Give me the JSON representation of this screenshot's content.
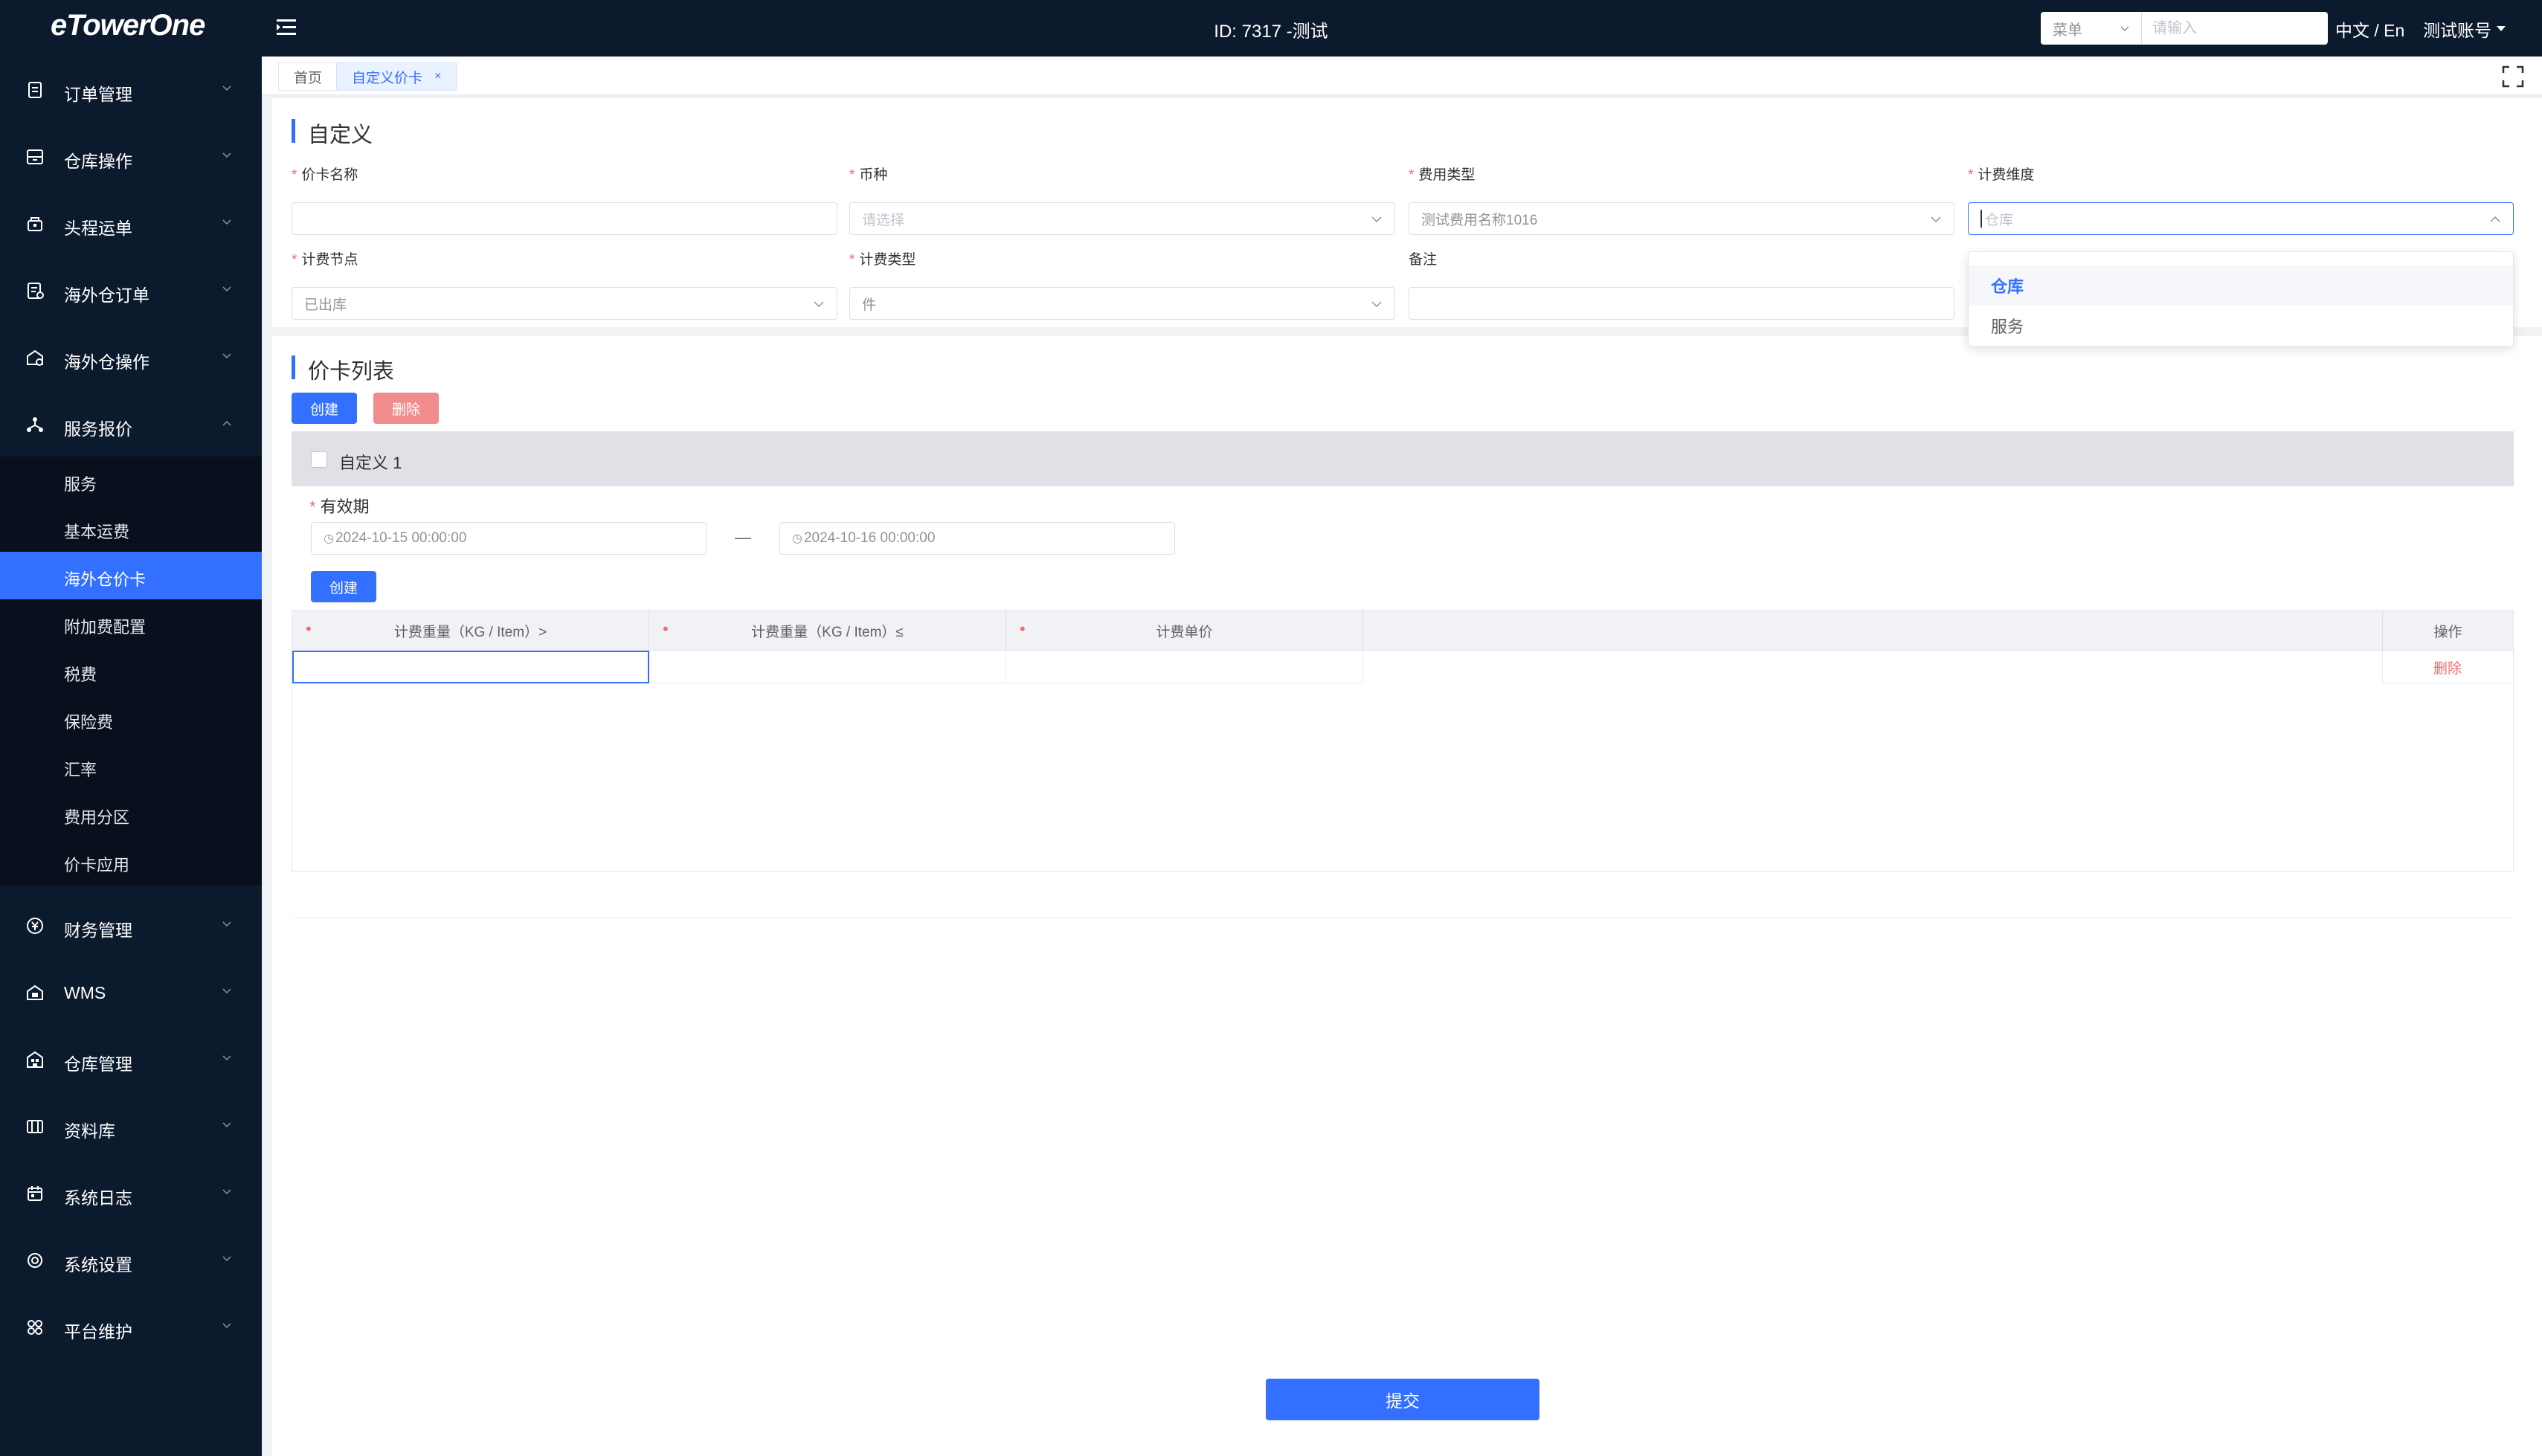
{
  "app": {
    "logo": "eTowerOne",
    "title": "ID: 7317 -测试",
    "search_select": "菜单",
    "search_placeholder": "请输入",
    "language": "中文 / En",
    "account": "测试账号"
  },
  "sidebar": {
    "items": [
      {
        "label": "订单管理",
        "icon": "document-icon"
      },
      {
        "label": "仓库操作",
        "icon": "warehouse-ops-icon"
      },
      {
        "label": "头程运单",
        "icon": "shipment-icon"
      },
      {
        "label": "海外仓订单",
        "icon": "order-list-icon"
      },
      {
        "label": "海外仓操作",
        "icon": "overseas-ops-icon"
      },
      {
        "label": "服务报价",
        "icon": "network-icon"
      },
      {
        "label": "财务管理",
        "icon": "currency-icon"
      },
      {
        "label": "WMS",
        "icon": "wms-icon"
      },
      {
        "label": "仓库管理",
        "icon": "building-icon"
      },
      {
        "label": "资料库",
        "icon": "database-icon"
      },
      {
        "label": "系统日志",
        "icon": "calendar-icon"
      },
      {
        "label": "系统设置",
        "icon": "settings-icon"
      },
      {
        "label": "平台维护",
        "icon": "apps-icon"
      }
    ],
    "submenu": [
      "服务",
      "基本运费",
      "海外仓价卡",
      "附加费配置",
      "税费",
      "保险费",
      "汇率",
      "费用分区",
      "价卡应用"
    ]
  },
  "tabs": [
    {
      "label": "首页"
    },
    {
      "label": "自定义价卡"
    }
  ],
  "form": {
    "section_title": "自定义",
    "card_name": {
      "label": "价卡名称",
      "value": ""
    },
    "currency": {
      "label": "币种",
      "placeholder": "请选择"
    },
    "fee_type": {
      "label": "费用类型",
      "value": "测试费用名称1016"
    },
    "billing_dimension": {
      "label": "计费维度",
      "placeholder": "仓库"
    },
    "billing_node": {
      "label": "计费节点",
      "value": "已出库"
    },
    "billing_type": {
      "label": "计费类型",
      "value": "件"
    },
    "remark": {
      "label": "备注",
      "value": ""
    },
    "dropdown_options": [
      "仓库",
      "服务"
    ]
  },
  "price_list": {
    "title": "价卡列表",
    "create_label": "创建",
    "delete_label": "删除",
    "group_name": "自定义 1",
    "validity_label": "有效期",
    "start_date": "2024-10-15 00:00:00",
    "end_date": "2024-10-16 00:00:00",
    "date_separator": "—",
    "row_create_label": "创建",
    "columns": [
      "计费重量（KG / Item）>",
      "计费重量（KG / Item）≤",
      "计费单价"
    ],
    "ops_header": "操作",
    "row_delete": "删除"
  },
  "submit_label": "提交",
  "colors": {
    "primary": "#3370ff",
    "danger": "#f56c6c",
    "sidebar_bg": "#0c1a2e"
  }
}
